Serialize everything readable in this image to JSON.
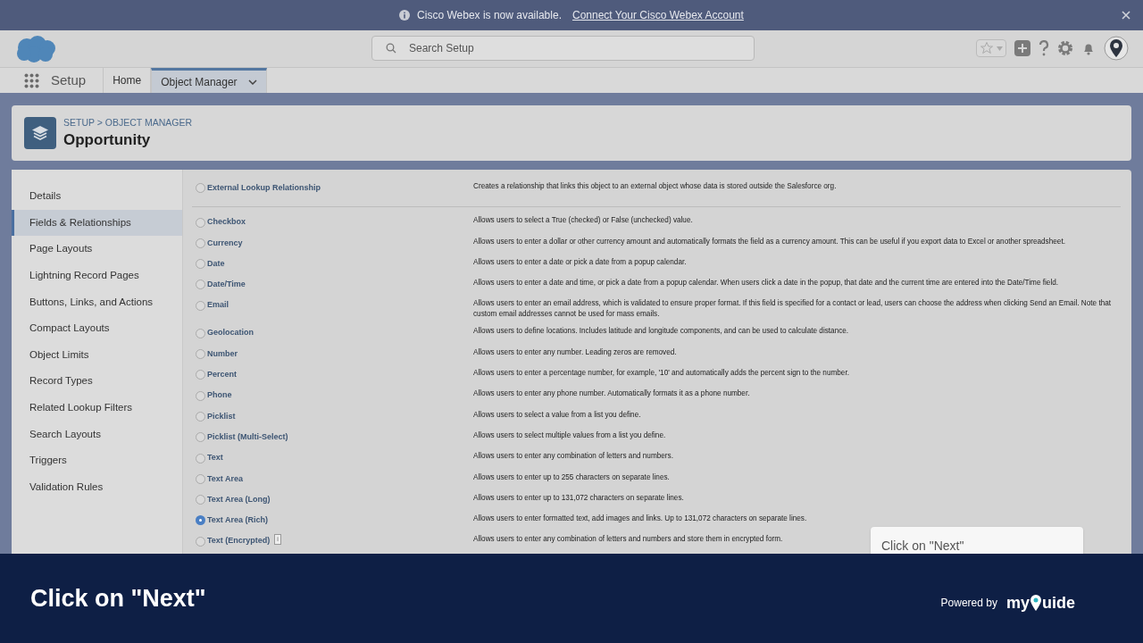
{
  "banner": {
    "text": "Cisco Webex is now available.",
    "link": "Connect Your Cisco Webex Account"
  },
  "search": {
    "placeholder": "Search Setup"
  },
  "nav": {
    "app": "Setup",
    "tabs": [
      {
        "label": "Home",
        "selected": false,
        "dropdown": false
      },
      {
        "label": "Object Manager",
        "selected": true,
        "dropdown": true
      }
    ]
  },
  "header": {
    "breadcrumb": "SETUP > OBJECT MANAGER",
    "title": "Opportunity"
  },
  "sidebar": {
    "items": [
      {
        "label": "Details",
        "selected": false
      },
      {
        "label": "Fields & Relationships",
        "selected": true
      },
      {
        "label": "Page Layouts",
        "selected": false
      },
      {
        "label": "Lightning Record Pages",
        "selected": false
      },
      {
        "label": "Buttons, Links, and Actions",
        "selected": false
      },
      {
        "label": "Compact Layouts",
        "selected": false
      },
      {
        "label": "Object Limits",
        "selected": false
      },
      {
        "label": "Record Types",
        "selected": false
      },
      {
        "label": "Related Lookup Filters",
        "selected": false
      },
      {
        "label": "Search Layouts",
        "selected": false
      },
      {
        "label": "Triggers",
        "selected": false
      },
      {
        "label": "Validation Rules",
        "selected": false
      }
    ]
  },
  "field_types_top": [
    {
      "label": "External Lookup Relationship",
      "description": "Creates a relationship that links this object to an external object whose data is stored outside the Salesforce org.",
      "selected": false
    }
  ],
  "field_types": [
    {
      "label": "Checkbox",
      "description": "Allows users to select a True (checked) or False (unchecked) value.",
      "selected": false
    },
    {
      "label": "Currency",
      "description": "Allows users to enter a dollar or other currency amount and automatically formats the field as a currency amount. This can be useful if you export data to Excel or another spreadsheet.",
      "selected": false
    },
    {
      "label": "Date",
      "description": "Allows users to enter a date or pick a date from a popup calendar.",
      "selected": false
    },
    {
      "label": "Date/Time",
      "description": "Allows users to enter a date and time, or pick a date from a popup calendar. When users click a date in the popup, that date and the current time are entered into the Date/Time field.",
      "selected": false
    },
    {
      "label": "Email",
      "description": "Allows users to enter an email address, which is validated to ensure proper format. If this field is specified for a contact or lead, users can choose the address when clicking Send an Email. Note that custom email addresses cannot be used for mass emails.",
      "selected": false
    },
    {
      "label": "Geolocation",
      "description": "Allows users to define locations. Includes latitude and longitude components, and can be used to calculate distance.",
      "selected": false
    },
    {
      "label": "Number",
      "description": "Allows users to enter any number. Leading zeros are removed.",
      "selected": false
    },
    {
      "label": "Percent",
      "description": "Allows users to enter a percentage number, for example, '10' and automatically adds the percent sign to the number.",
      "selected": false
    },
    {
      "label": "Phone",
      "description": "Allows users to enter any phone number. Automatically formats it as a phone number.",
      "selected": false
    },
    {
      "label": "Picklist",
      "description": "Allows users to select a value from a list you define.",
      "selected": false
    },
    {
      "label": "Picklist (Multi-Select)",
      "description": "Allows users to select multiple values from a list you define.",
      "selected": false
    },
    {
      "label": "Text",
      "description": "Allows users to enter any combination of letters and numbers.",
      "selected": false
    },
    {
      "label": "Text Area",
      "description": "Allows users to enter up to 255 characters on separate lines.",
      "selected": false
    },
    {
      "label": "Text Area (Long)",
      "description": "Allows users to enter up to 131,072 characters on separate lines.",
      "selected": false
    },
    {
      "label": "Text Area (Rich)",
      "description": "Allows users to enter formatted text, add images and links. Up to 131,072 characters on separate lines.",
      "selected": true
    },
    {
      "label": "Text (Encrypted)",
      "description": "Allows users to enter any combination of letters and numbers and store them in encrypted form.",
      "selected": false,
      "info_badge": "i"
    }
  ],
  "tooltip": {
    "text": "Click on \"Next\""
  },
  "guide_bar": {
    "instruction": "Click on \"Next\"",
    "powered_by": "Powered by",
    "logo_left": "my",
    "logo_right": "uide"
  }
}
